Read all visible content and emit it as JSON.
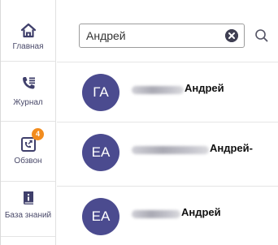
{
  "sidebar": {
    "items": [
      {
        "icon": "home-icon",
        "label": "Главная"
      },
      {
        "icon": "phone-log-icon",
        "label": "Журнал"
      },
      {
        "icon": "dialer-icon",
        "label": "Обзвон",
        "badge": "4"
      },
      {
        "icon": "knowledge-book-icon",
        "label": "База знаний"
      }
    ]
  },
  "search": {
    "value": "Андрей",
    "clear_icon": "clear-icon",
    "search_icon": "search-icon"
  },
  "contacts": [
    {
      "initials": "ГА",
      "name_visible": "Андрей"
    },
    {
      "initials": "ЕА",
      "name_visible": "Андрей-"
    },
    {
      "initials": "ЕА",
      "name_visible": "Андрей"
    }
  ],
  "colors": {
    "avatar": "#4b4b8f",
    "badge": "#f28c1e",
    "icon": "#3f3f6b"
  }
}
